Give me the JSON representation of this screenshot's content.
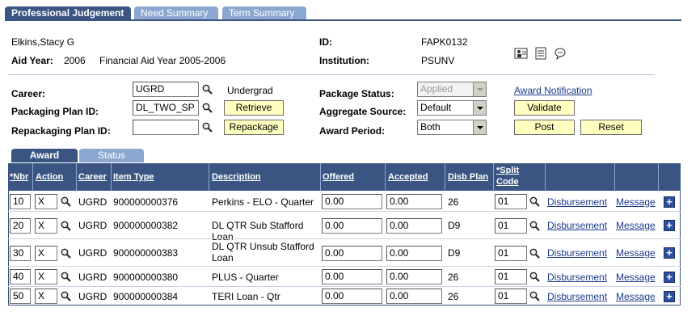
{
  "tabs": {
    "professional_judgement": "Professional Judgement",
    "need_summary": "Need Summary",
    "term_summary": "Term Summary"
  },
  "student": {
    "name": "Elkins,Stacy G",
    "aid_year_label": "Aid Year:",
    "aid_year": "2006",
    "aid_year_desc": "Financial Aid Year 2005-2006",
    "id_label": "ID:",
    "id": "FAPK0132",
    "institution_label": "Institution:",
    "institution": "PSUNV"
  },
  "form": {
    "career_label": "Career:",
    "career_value": "UGRD",
    "career_desc": "Undergrad",
    "packaging_plan_label": "Packaging Plan ID:",
    "packaging_plan_value": "DL_TWO_SP",
    "repackaging_plan_label": "Repackaging Plan ID:",
    "repackaging_plan_value": "",
    "retrieve_button": "Retrieve",
    "repackage_button": "Repackage",
    "package_status_label": "Package Status:",
    "package_status_value": "Applied",
    "aggregate_source_label": "Aggregate Source:",
    "aggregate_source_value": "Default",
    "award_period_label": "Award Period:",
    "award_period_value": "Both",
    "award_notification_link": "Award Notification",
    "validate_button": "Validate",
    "post_button": "Post",
    "reset_button": "Reset"
  },
  "subtabs": {
    "award": "Award",
    "status": "Status"
  },
  "grid": {
    "headers": {
      "nbr": "*Nbr",
      "action": "Action",
      "career": "Career",
      "item_type": "Item Type",
      "description": "Description",
      "offered": "Offered",
      "accepted": "Accepted",
      "disb_plan": "Disb Plan",
      "split_code_1": "*Split",
      "split_code_2": "Code"
    },
    "rows": [
      {
        "nbr": "10",
        "action": "X",
        "career": "UGRD",
        "item_type": "900000000376",
        "description": "Perkins - ELO - Quarter",
        "offered": "0.00",
        "accepted": "0.00",
        "disb_plan": "26",
        "split_code": "01",
        "disbursement": "Disbursement",
        "message": "Message"
      },
      {
        "nbr": "20",
        "action": "X",
        "career": "UGRD",
        "item_type": "900000000382",
        "description": "DL QTR Sub Stafford Loan",
        "offered": "0.00",
        "accepted": "0.00",
        "disb_plan": "D9",
        "split_code": "01",
        "disbursement": "Disbursement",
        "message": "Message"
      },
      {
        "nbr": "30",
        "action": "X",
        "career": "UGRD",
        "item_type": "900000000383",
        "description": "DL QTR Unsub Stafford Loan",
        "offered": "0.00",
        "accepted": "0.00",
        "disb_plan": "D9",
        "split_code": "01",
        "disbursement": "Disbursement",
        "message": "Message"
      },
      {
        "nbr": "40",
        "action": "X",
        "career": "UGRD",
        "item_type": "900000000380",
        "description": "PLUS - Quarter",
        "offered": "0.00",
        "accepted": "0.00",
        "disb_plan": "26",
        "split_code": "01",
        "disbursement": "Disbursement",
        "message": "Message"
      },
      {
        "nbr": "50",
        "action": "X",
        "career": "UGRD",
        "item_type": "900000000384",
        "description": "TERI Loan - Qtr",
        "offered": "0.00",
        "accepted": "0.00",
        "disb_plan": "26",
        "split_code": "01",
        "disbursement": "Disbursement",
        "message": "Message"
      }
    ]
  },
  "icons": {
    "lookup": "magnifier-icon",
    "toolbar_1": "people-chart-icon",
    "toolbar_2": "notepad-icon",
    "toolbar_3": "speech-bubble-icon",
    "add_row": "plus-icon"
  },
  "colors": {
    "tab_active": "#3a5582",
    "tab_inactive": "#8ba7cf",
    "button_bg": "#ffffc0",
    "link": "#1c3a8a"
  }
}
